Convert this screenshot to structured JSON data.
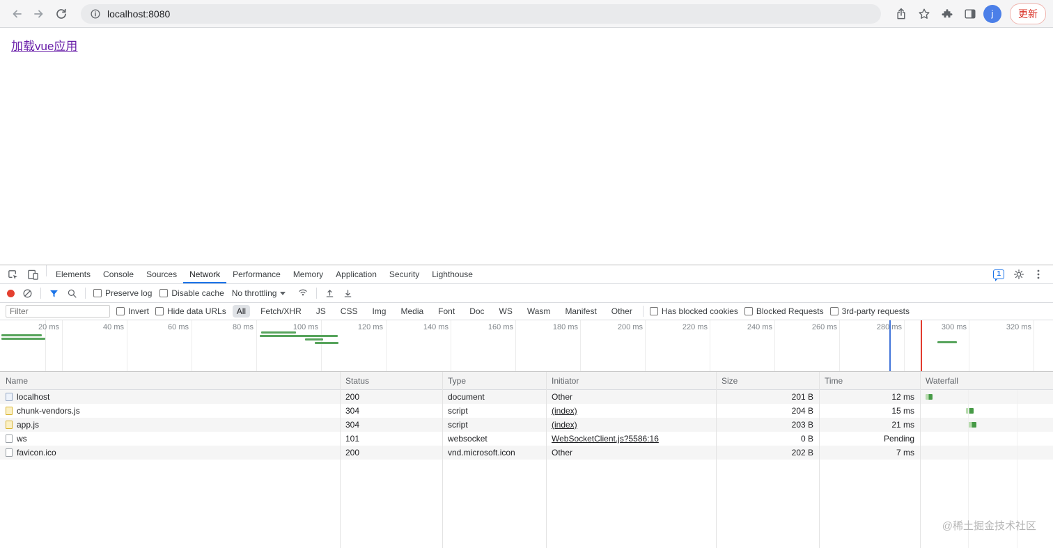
{
  "browser": {
    "url": "localhost:8080",
    "update_label": "更新",
    "avatar_initial": "j"
  },
  "page": {
    "link_label": "加载vue应用"
  },
  "colors": {
    "accent_blue": "#1a73e8",
    "record_red": "#e4402f",
    "waterfall_green": "#469a46",
    "link_purple": "#681da8",
    "update_red": "#d93025"
  },
  "devtools": {
    "tabs": [
      "Elements",
      "Console",
      "Sources",
      "Network",
      "Performance",
      "Memory",
      "Application",
      "Security",
      "Lighthouse"
    ],
    "selected_tab": "Network",
    "messages_badge": "1",
    "network_toolbar": {
      "preserve_log_label": "Preserve log",
      "disable_cache_label": "Disable cache",
      "throttling_value": "No throttling"
    },
    "filter_bar": {
      "filter_placeholder": "Filter",
      "invert_label": "Invert",
      "hide_data_urls_label": "Hide data URLs",
      "type_filters": [
        "All",
        "Fetch/XHR",
        "JS",
        "CSS",
        "Img",
        "Media",
        "Font",
        "Doc",
        "WS",
        "Wasm",
        "Manifest",
        "Other"
      ],
      "selected_type_filter": "All",
      "has_blocked_cookies_label": "Has blocked cookies",
      "blocked_requests_label": "Blocked Requests",
      "third_party_label": "3rd-party requests"
    },
    "overview": {
      "tick_labels": [
        "20 ms",
        "40 ms",
        "60 ms",
        "80 ms",
        "100 ms",
        "120 ms",
        "140 ms",
        "160 ms",
        "180 ms",
        "200 ms",
        "220 ms",
        "240 ms",
        "260 ms",
        "280 ms",
        "300 ms",
        "320 ms"
      ]
    },
    "requests_table": {
      "columns": [
        "Name",
        "Status",
        "Type",
        "Initiator",
        "Size",
        "Time",
        "Waterfall"
      ],
      "rows": [
        {
          "name": "localhost",
          "status": "200",
          "type": "document",
          "initiator": "Other",
          "size": "201 B",
          "time": "12 ms"
        },
        {
          "name": "chunk-vendors.js",
          "status": "304",
          "type": "script",
          "initiator": "(index)",
          "size": "204 B",
          "time": "15 ms"
        },
        {
          "name": "app.js",
          "status": "304",
          "type": "script",
          "initiator": "(index)",
          "size": "203 B",
          "time": "21 ms"
        },
        {
          "name": "ws",
          "status": "101",
          "type": "websocket",
          "initiator": "WebSocketClient.js?5586:16",
          "size": "0 B",
          "time": "Pending"
        },
        {
          "name": "favicon.ico",
          "status": "200",
          "type": "vnd.microsoft.icon",
          "initiator": "Other",
          "size": "202 B",
          "time": "7 ms"
        }
      ]
    },
    "watermark": "@稀土掘金技术社区"
  }
}
